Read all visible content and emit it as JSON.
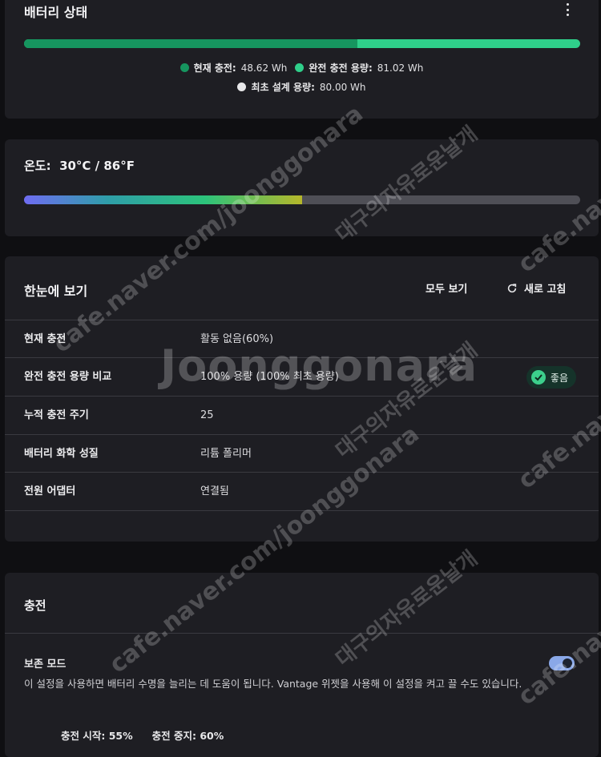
{
  "battery": {
    "title": "배터리 상태",
    "current_label": "현재 충전:",
    "current_value": "48.62 Wh",
    "full_label": "완전 충전 용량:",
    "full_value": "81.02 Wh",
    "design_label": "최초 설계 용량:",
    "design_value": "80.00 Wh",
    "current_fraction": 0.6,
    "colors": {
      "current": "#16955f",
      "full": "#2fcf8a",
      "design": "#e8e8ea"
    }
  },
  "temperature": {
    "label": "온도:",
    "value": "30°C / 86°F",
    "fraction": 0.5
  },
  "glance": {
    "title": "한눈에 보기",
    "view_all": "모두 보기",
    "refresh": "새로 고침",
    "rows": [
      {
        "label": "현재 충전",
        "value": "활동 없음(60%)"
      },
      {
        "label": "완전 충전 용량 비교",
        "value": "100% 용량 (100% 최초 용량)",
        "badge": "좋음"
      },
      {
        "label": "누적 충전 주기",
        "value": "25"
      },
      {
        "label": "배터리 화학 성질",
        "value": "리튬 폴리머"
      },
      {
        "label": "전원 어댑터",
        "value": "연결됨"
      }
    ]
  },
  "charging": {
    "title": "충전",
    "mode_label": "보존 모드",
    "mode_desc": "이 설정을 사용하면 배터리 수명을 늘리는 데 도움이 됩니다. Vantage 위젯을 사용해 이 설정을 켜고 끌 수도 있습니다.",
    "mode_enabled": true,
    "start_label": "충전 시작: 55%",
    "stop_label": "충전 중지: 60%"
  },
  "watermarks": {
    "main": "Joonggonara",
    "url": "cafe.naver.com/joonggonara",
    "domain": "cafe.naver",
    "slogan": "대구의자유로운날개"
  }
}
